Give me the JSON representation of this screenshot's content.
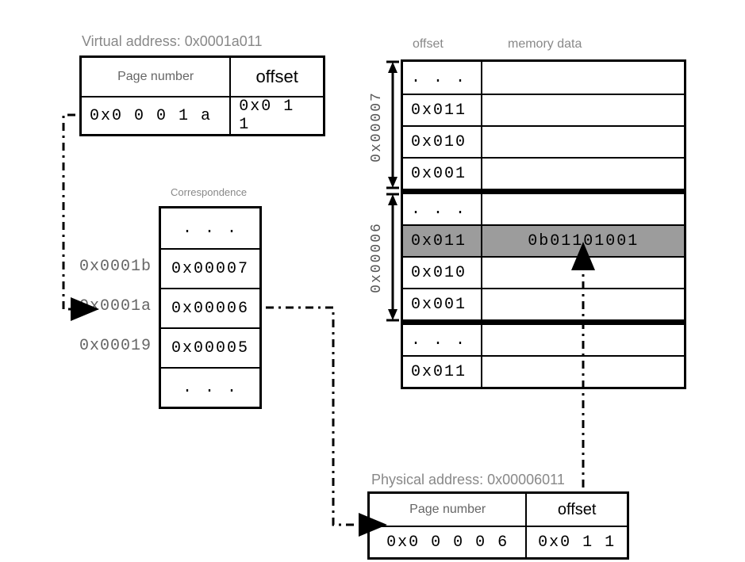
{
  "virtual_address": {
    "title": "Virtual address: 0x0001a011",
    "page_number_header": "Page number",
    "offset_header": "offset",
    "page_number_value": "0x0  0  0  1  a",
    "offset_value": "0x0  1  1"
  },
  "page_table": {
    "title": "Correspondence",
    "ellipsis_top": ". . .",
    "ellipsis_bottom": ". . .",
    "rows": [
      {
        "virtual_page": "0x0001b",
        "physical_frame": "0x00007"
      },
      {
        "virtual_page": "0x0001a",
        "physical_frame": "0x00006"
      },
      {
        "virtual_page": "0x00019",
        "physical_frame": "0x00005"
      }
    ]
  },
  "memory": {
    "offset_header": "offset",
    "data_header": "memory data",
    "frame7_label": "0x00007",
    "frame6_label": "0x00006",
    "frame7_rows": [
      {
        "offset": ". . .",
        "data": ""
      },
      {
        "offset": "0x011",
        "data": ""
      },
      {
        "offset": "0x010",
        "data": ""
      },
      {
        "offset": "0x001",
        "data": ""
      }
    ],
    "frame6_rows": [
      {
        "offset": ". . .",
        "data": ""
      },
      {
        "offset": "0x011",
        "data": "0b01101001",
        "highlight": true
      },
      {
        "offset": "0x010",
        "data": ""
      },
      {
        "offset": "0x001",
        "data": ""
      }
    ],
    "below_rows": [
      {
        "offset": ". . .",
        "data": ""
      },
      {
        "offset": "0x011",
        "data": ""
      }
    ]
  },
  "physical_address": {
    "title": "Physical address: 0x00006011",
    "page_number_header": "Page number",
    "offset_header": "offset",
    "page_number_value": "0x0  0  0  0  6",
    "offset_value": "0x0  1  1"
  }
}
